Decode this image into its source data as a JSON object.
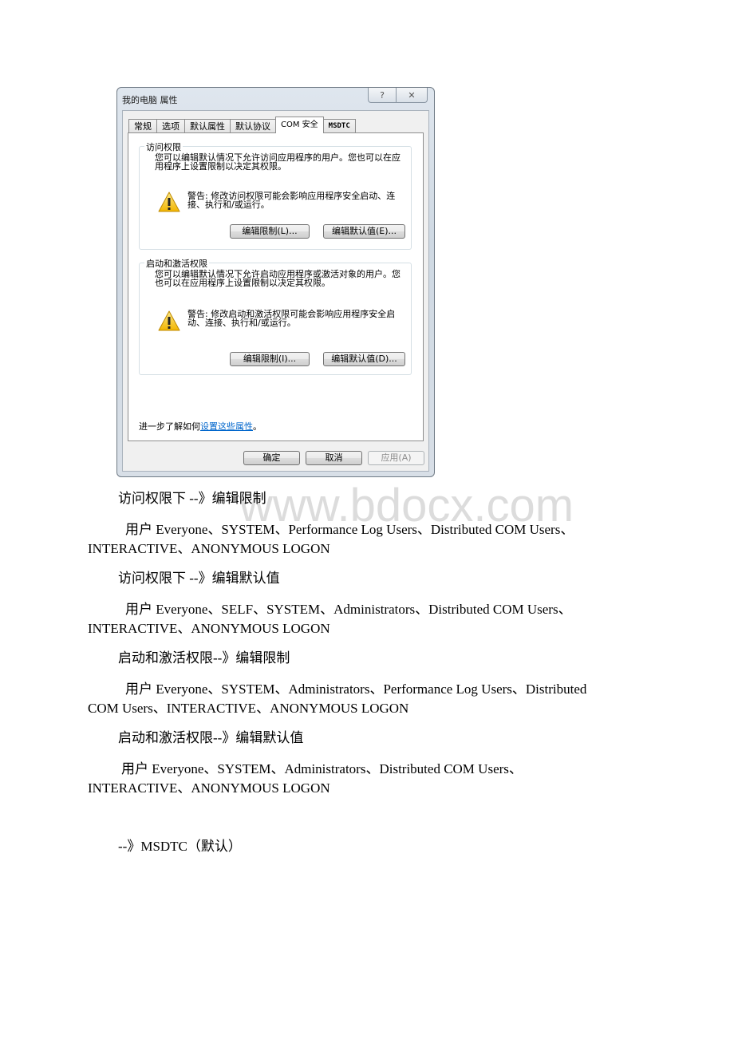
{
  "dialog": {
    "title": "我的电脑 属性",
    "help_button": "?",
    "close_button": "✕",
    "tabs": [
      {
        "label": "常规",
        "active": false
      },
      {
        "label": "选项",
        "active": false
      },
      {
        "label": "默认属性",
        "active": false
      },
      {
        "label": "默认协议",
        "active": false
      },
      {
        "label": "COM 安全",
        "active": true
      },
      {
        "label": "MSDTC",
        "active": false
      }
    ],
    "access_group": {
      "label": "访问权限",
      "description": "您可以编辑默认情况下允许访问应用程序的用户。您也可以在应用程序上设置限制以决定其权限。",
      "warning": "警告: 修改访问权限可能会影响应用程序安全启动、连接、执行和/或运行。",
      "edit_limits_button": "编辑限制(L)...",
      "edit_default_button": "编辑默认值(E)..."
    },
    "launch_group": {
      "label": "启动和激活权限",
      "description": "您可以编辑默认情况下允许启动应用程序或激活对象的用户。您也可以在应用程序上设置限制以决定其权限。",
      "warning": "警告: 修改启动和激活权限可能会影响应用程序安全启动、连接、执行和/或运行。",
      "edit_limits_button": "编辑限制(I)...",
      "edit_default_button": "编辑默认值(D)..."
    },
    "learn_more_prefix": "进一步了解如何",
    "learn_more_link": "设置这些属性",
    "learn_more_suffix": "。",
    "ok_button": "确定",
    "cancel_button": "取消",
    "apply_button": "应用(A)"
  },
  "watermark": "www.bdocx.com",
  "document": {
    "sections": [
      {
        "heading": "访问权限下 --》编辑限制",
        "line1": "用户 Everyone、SYSTEM、Performance Log Users、Distributed COM Users、",
        "line2": "INTERACTIVE、ANONYMOUS LOGON"
      },
      {
        "heading": "访问权限下 --》编辑默认值",
        "line1": "用户 Everyone、SELF、SYSTEM、Administrators、Distributed COM Users、",
        "line2": "INTERACTIVE、ANONYMOUS LOGON"
      },
      {
        "heading": "启动和激活权限--》编辑限制",
        "line1": "用户 Everyone、SYSTEM、Administrators、Performance Log Users、Distributed",
        "line2": "COM Users、INTERACTIVE、ANONYMOUS LOGON"
      },
      {
        "heading": "启动和激活权限--》编辑默认值",
        "line1": "用户 Everyone、SYSTEM、Administrators、Distributed COM Users、",
        "line2": "INTERACTIVE、ANONYMOUS LOGON"
      }
    ],
    "msdtc_heading": "--》MSDTC（默认）"
  }
}
